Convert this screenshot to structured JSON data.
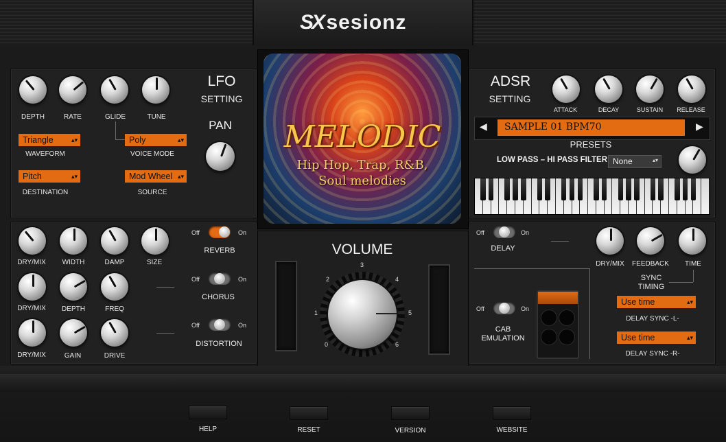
{
  "brand": {
    "logo_mark": "SX",
    "name": "sesionz"
  },
  "lfo": {
    "title": "LFO",
    "subtitle": "SETTING",
    "knobs": [
      "DEPTH",
      "RATE",
      "GLIDE",
      "TUNE"
    ],
    "waveform": {
      "value": "Triangle",
      "label": "WAVEFORM"
    },
    "voice_mode": {
      "value": "Poly",
      "label": "VOICE MODE"
    },
    "destination": {
      "value": "Pitch",
      "label": "DESTINATION"
    },
    "source": {
      "value": "Mod Wheel",
      "label": "SOURCE"
    },
    "pan_label": "PAN"
  },
  "artwork": {
    "title": "MELODIC",
    "line1": "Hip Hop, Trap, R&B,",
    "line2": "Soul melodies"
  },
  "adsr": {
    "title": "ADSR",
    "subtitle": "SETTING",
    "knobs": [
      "ATTACK",
      "DECAY",
      "SUSTAIN",
      "RELEASE"
    ],
    "preset_name": "SAMPLE 01 BPM70",
    "presets_label": "PRESETS",
    "filter_label": "LOW PASS – HI PASS FILTER",
    "filter_value": "None"
  },
  "fx": {
    "reverb": {
      "off": "Off",
      "on": "On",
      "name": "REVERB",
      "knobs": [
        "DRY/MIX",
        "WIDTH",
        "DAMP",
        "SIZE"
      ],
      "enabled": true
    },
    "chorus": {
      "off": "Off",
      "on": "On",
      "name": "CHORUS",
      "knobs": [
        "DRY/MIX",
        "DEPTH",
        "FREQ"
      ],
      "enabled": false
    },
    "distortion": {
      "off": "Off",
      "on": "On",
      "name": "DISTORTION",
      "knobs": [
        "DRY/MIX",
        "GAIN",
        "DRIVE"
      ],
      "enabled": false
    }
  },
  "volume": {
    "label": "VOLUME",
    "scale": [
      "0",
      "1",
      "2",
      "3",
      "4",
      "5",
      "6"
    ]
  },
  "delay": {
    "off": "Off",
    "on": "On",
    "name": "DELAY",
    "knobs": [
      "DRY/MIX",
      "FEEDBACK",
      "TIME"
    ],
    "sync_timing_1": "SYNC",
    "sync_timing_2": "TIMING",
    "sync_l": {
      "value": "Use time",
      "label": "DELAY SYNC -L-"
    },
    "sync_r": {
      "value": "Use time",
      "label": "DELAY SYNC -R-"
    }
  },
  "cab": {
    "off": "Off",
    "on": "On",
    "name_1": "CAB",
    "name_2": "EMULATION"
  },
  "footer": {
    "help": "HELP",
    "reset": "RESET",
    "version": "VERSION",
    "website": "WEBSITE"
  },
  "colors": {
    "accent": "#e36b12",
    "panel": "#212121",
    "background": "#1b1b1b"
  }
}
